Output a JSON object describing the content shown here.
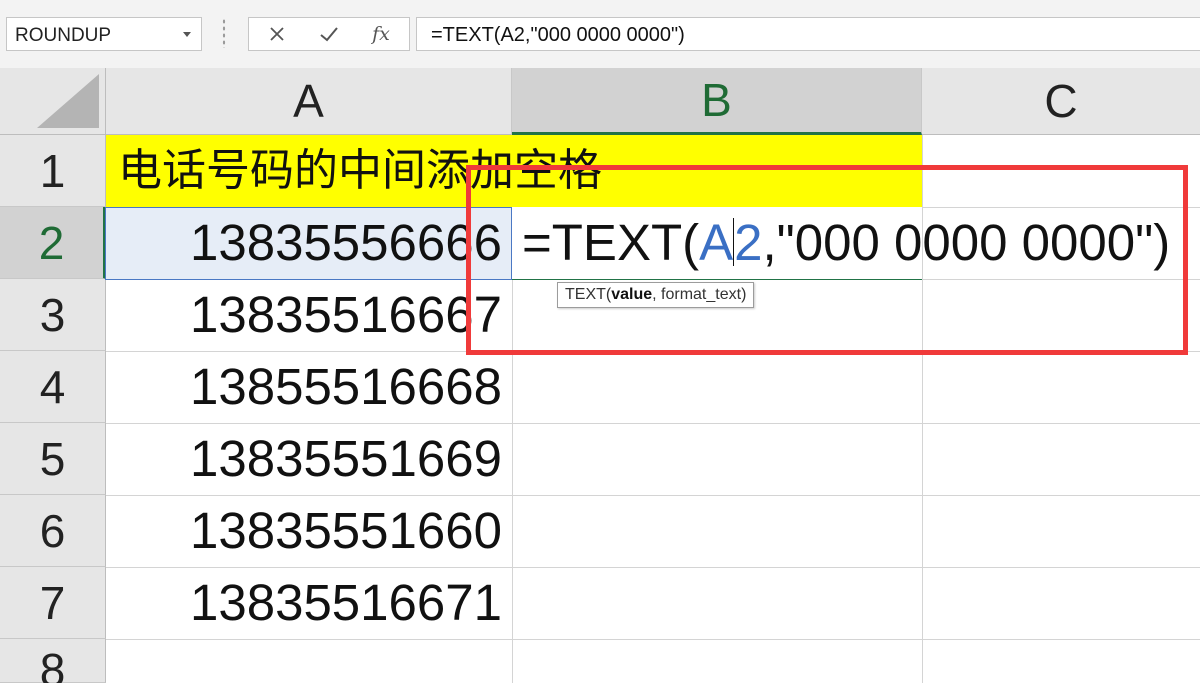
{
  "formula_bar": {
    "name_box": "ROUNDUP",
    "fx_label": "fx",
    "formula": "=TEXT(A2,\"000 0000 0000\")",
    "icons": [
      "cancel-icon",
      "confirm-icon",
      "function-icon"
    ]
  },
  "columns": [
    "A",
    "B",
    "C"
  ],
  "active_column": "B",
  "rows": [
    "1",
    "2",
    "3",
    "4",
    "5",
    "6",
    "7",
    "8"
  ],
  "active_row": "2",
  "cells": {
    "A1": "电话号码的中间添加空格",
    "A2": "13835556666",
    "A3": "13835516667",
    "A4": "13855516668",
    "A5": "13835551669",
    "A6": "13835551660",
    "A7": "13835516671"
  },
  "editing_cell": {
    "address": "B2",
    "prefix": "=TEXT(",
    "ref_a": "A",
    "ref_b": "2",
    "suffix": ",\"000 0000 0000\")"
  },
  "tooltip": {
    "fn": "TEXT(",
    "arg_bold": "value",
    "rest": ", format_text)"
  },
  "colors": {
    "title_fill": "#ffff00",
    "reference_blue": "#3a6fc4",
    "active_header_green": "#217346",
    "highlight_red": "#f03a3a"
  }
}
